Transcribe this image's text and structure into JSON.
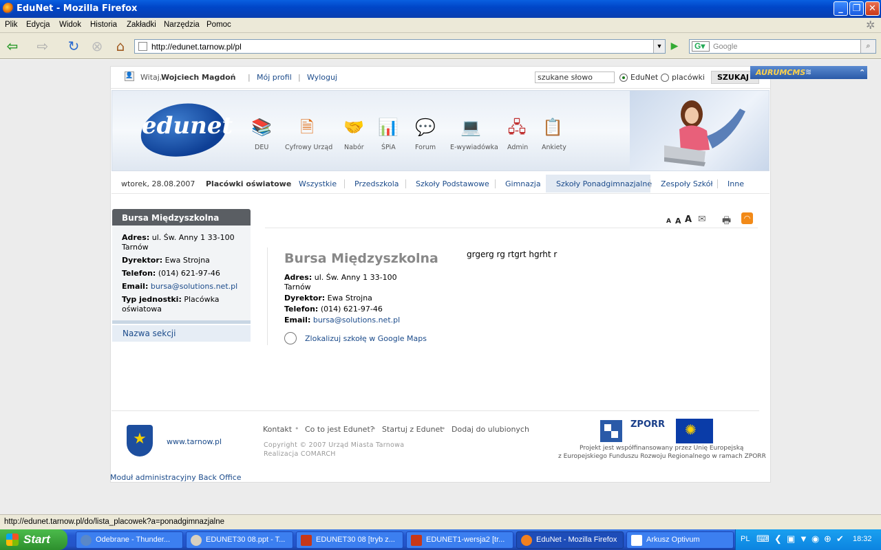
{
  "window": {
    "title": "EduNet - Mozilla Firefox"
  },
  "menu": [
    "Plik",
    "Edycja",
    "Widok",
    "Historia",
    "Zakładki",
    "Narzędzia",
    "Pomoc"
  ],
  "toolbar": {
    "url": "http://edunet.tarnow.pl/pl",
    "search_placeholder": "Google"
  },
  "topstrip": {
    "greeting": "Witaj,",
    "user": "Wojciech Magdoń",
    "profile": "Mój profil",
    "logout": "Wyloguj",
    "search_placeholder": "szukane słowo",
    "radio1": "EduNet",
    "radio2": "placówki",
    "search_btn": "SZUKAJ »",
    "cms": "AURUMCMS"
  },
  "banner": {
    "logo": "edunet",
    "icons": [
      "DEU",
      "Cyfrowy Urząd",
      "Nabór",
      "ŚPiA",
      "Forum",
      "E-wywiadówka",
      "Admin",
      "Ankiety"
    ]
  },
  "navrow": {
    "date": "wtorek, 28.08.2007",
    "label": "Placówki oświatowe",
    "items": [
      "Wszystkie",
      "Przedszkola",
      "Szkoły Podstawowe",
      "Gimnazja",
      "Szkoły Ponadgimnazjalne",
      "Zespoły Szkół",
      "Inne"
    ]
  },
  "left": {
    "title": "Bursa Międzyszkolna",
    "adres_k": "Adres:",
    "adres_v1": "ul. Św. Anny 1 33-100",
    "adres_v2": "Tarnów",
    "dyr_k": "Dyrektor:",
    "dyr_v": "Ewa Strojna",
    "tel_k": "Telefon:",
    "tel_v": "(014) 621-97-46",
    "mail_k": "Email:",
    "mail_v": "bursa@solutions.net.pl",
    "typ_k": "Typ jednostki:",
    "typ_v1": "Placówka",
    "typ_v2": "oświatowa",
    "section": "Nazwa sekcji"
  },
  "main": {
    "font_sizes": [
      "A",
      "A",
      "A"
    ],
    "title": "Bursa Międzyszkolna",
    "note": "grgerg rg rtgrt hgrht r",
    "adres_k": "Adres:",
    "adres_v1": "ul. Św. Anny 1 33-100",
    "adres_v2": "Tarnów",
    "dyr_k": "Dyrektor:",
    "dyr_v": "Ewa Strojna",
    "tel_k": "Telefon:",
    "tel_v": "(014) 621-97-46",
    "mail_k": "Email:",
    "mail_v": "bursa@solutions.net.pl",
    "map_link": "Zlokalizuj szkołę w Google Maps"
  },
  "footer": {
    "city_link": "www.tarnow.pl",
    "links": [
      "Kontakt",
      "Co to jest Edunet?",
      "Startuj z Edunet",
      "Dodaj do ulubionych"
    ],
    "copyright": "Copyright © 2007 Urząd Miasta Tarnowa",
    "realizacja": "Realizacja COMARCH",
    "zporr": "ZPORR",
    "project1": "Projekt jest współfinansowany przez Unię Europejską",
    "project2": "z Europejskiego Funduszu Rozwoju Regionalnego w ramach ZPORR",
    "backoffice": "Moduł administracyjny Back Office"
  },
  "status": "http://edunet.tarnow.pl/do/lista_placowek?a=ponadgimnazjalne",
  "taskbar": {
    "start": "Start",
    "items": [
      "Odebrane - Thunder...",
      "EDUNET30 08.ppt - T...",
      "EDUNET30 08 [tryb z...",
      "EDUNET1-wersja2 [tr...",
      "EduNet - Mozilla Firefox",
      "Arkusz Optivum"
    ],
    "lang": "PL",
    "clock": "18:32"
  }
}
